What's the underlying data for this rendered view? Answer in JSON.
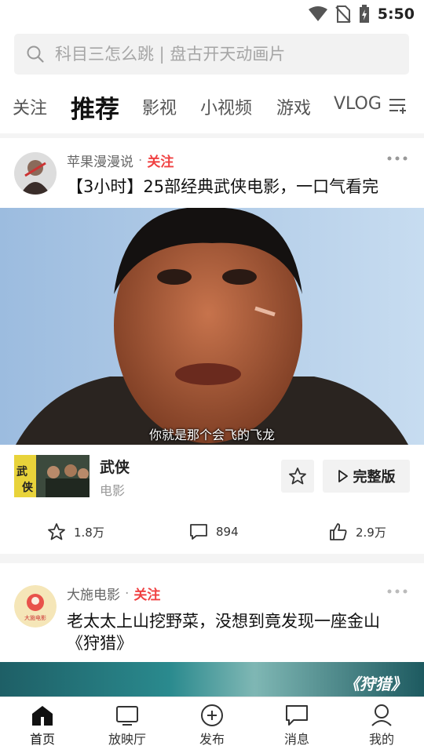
{
  "status_bar": {
    "time": "5:50",
    "icons": [
      "wifi-icon",
      "no-sim-icon",
      "battery-charging-icon"
    ]
  },
  "search": {
    "placeholder": "科目三怎么跳 | 盘古开天动画片"
  },
  "tabs": [
    {
      "label": "关注"
    },
    {
      "label": "推荐",
      "active": true
    },
    {
      "label": "影视"
    },
    {
      "label": "小视频"
    },
    {
      "label": "游戏"
    },
    {
      "label": "VLOG"
    }
  ],
  "feed": [
    {
      "author": "苹果漫漫说",
      "separator": "·",
      "follow_label": "关注",
      "title": "【3小时】25部经典武侠电影，一口气看完",
      "video_subtitle": "你就是那个会飞的飞龙",
      "movie": {
        "name": "武侠",
        "type": "电影",
        "full_label": "完整版"
      },
      "stats": {
        "favorites": "1.8万",
        "comments": "894",
        "likes": "2.9万"
      }
    },
    {
      "author": "大施电影",
      "separator": "·",
      "follow_label": "关注",
      "title": "老太太上山挖野菜，没想到竟发现一座金山《狩猎》",
      "avatar_text": "大施电影",
      "thumbnail_overlay": "《狩猎》"
    }
  ],
  "bottom_nav": [
    {
      "label": "首页",
      "icon": "home-icon",
      "active": true
    },
    {
      "label": "放映厅",
      "icon": "tv-icon"
    },
    {
      "label": "发布",
      "icon": "plus-circle-icon"
    },
    {
      "label": "消息",
      "icon": "message-icon"
    },
    {
      "label": "我的",
      "icon": "user-icon"
    }
  ],
  "colors": {
    "accent": "#f04142",
    "text": "#222222",
    "muted": "#999999"
  }
}
